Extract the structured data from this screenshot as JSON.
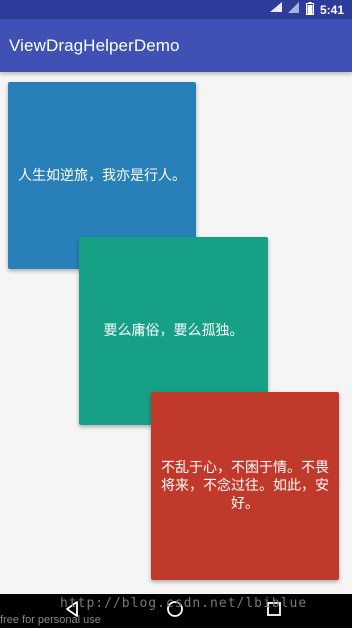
{
  "status_bar": {
    "time": "5:41",
    "icons": [
      "wifi-icon",
      "signal-icon",
      "battery-icon"
    ]
  },
  "app_bar": {
    "title": "ViewDragHelperDemo"
  },
  "cards": [
    {
      "text": "人生如逆旅，我亦是行人。",
      "color": "#2980b9"
    },
    {
      "text": "要么庸俗，要么孤独。",
      "color": "#16a085"
    },
    {
      "text": "不乱于心，不困于情。不畏将来，不念过往。如此，安好。",
      "color": "#c0392b"
    }
  ],
  "nav_bar": {
    "icons": [
      "back-icon",
      "home-icon",
      "recent-apps-icon"
    ]
  },
  "overlay": {
    "watermark": "http://blog.csdn.net/lbiblue",
    "footer_text": "free for personal use"
  },
  "colors": {
    "status_bar": "#2f3b9a",
    "app_bar": "#3f51b5",
    "background": "#f5f5f5"
  }
}
